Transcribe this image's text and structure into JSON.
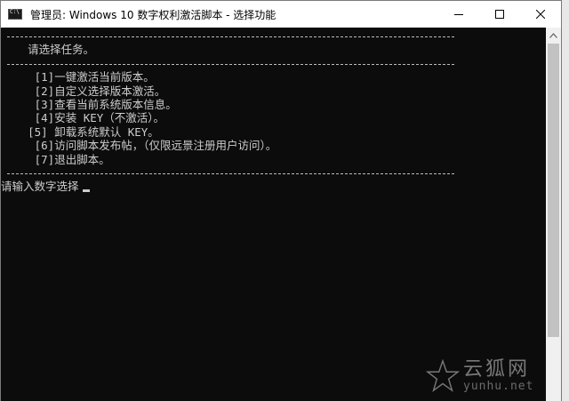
{
  "window": {
    "title": "管理员:  Windows 10 数字权利激活脚本 - 选择功能",
    "icon_label": "C:\\"
  },
  "console": {
    "heading": "    请选择任务。",
    "options": [
      "     [1]一键激活当前版本。",
      "     [2]自定义选择版本激活。",
      "     [3]查看当前系统版本信息。",
      "     [4]安装 KEY（不激活）。",
      "    [5] 卸载系统默认 KEY。",
      "     [6]访问脚本发布帖，（仅限远景注册用户访问）。",
      "     [7]退出脚本。"
    ],
    "prompt": "请输入数字选择"
  },
  "watermark": {
    "name": "云狐网",
    "url": "yunhu.net"
  },
  "colors": {
    "console_bg": "#0c0c0c",
    "console_fg": "#cccccc",
    "titlebar_bg": "#ffffff"
  },
  "icons": {
    "minimize": "minimize-icon",
    "maximize": "maximize-icon",
    "close": "close-icon",
    "scroll_up": "chevron-up-icon"
  }
}
